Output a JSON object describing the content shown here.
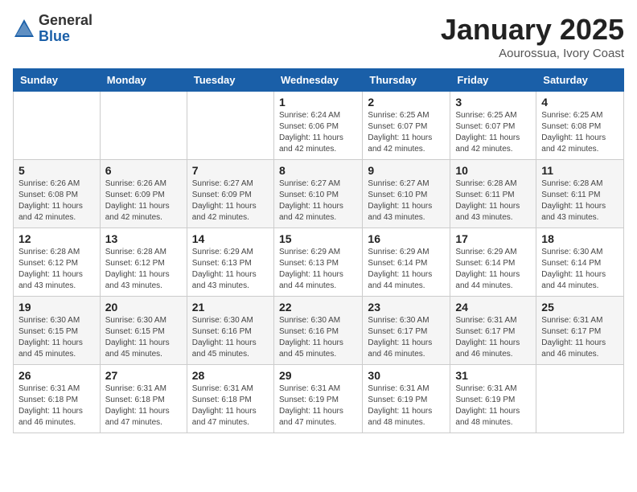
{
  "header": {
    "logo_general": "General",
    "logo_blue": "Blue",
    "title": "January 2025",
    "location": "Aourossua, Ivory Coast"
  },
  "weekdays": [
    "Sunday",
    "Monday",
    "Tuesday",
    "Wednesday",
    "Thursday",
    "Friday",
    "Saturday"
  ],
  "weeks": [
    [
      {
        "day": "",
        "sunrise": "",
        "sunset": "",
        "daylight": ""
      },
      {
        "day": "",
        "sunrise": "",
        "sunset": "",
        "daylight": ""
      },
      {
        "day": "",
        "sunrise": "",
        "sunset": "",
        "daylight": ""
      },
      {
        "day": "1",
        "sunrise": "Sunrise: 6:24 AM",
        "sunset": "Sunset: 6:06 PM",
        "daylight": "Daylight: 11 hours and 42 minutes."
      },
      {
        "day": "2",
        "sunrise": "Sunrise: 6:25 AM",
        "sunset": "Sunset: 6:07 PM",
        "daylight": "Daylight: 11 hours and 42 minutes."
      },
      {
        "day": "3",
        "sunrise": "Sunrise: 6:25 AM",
        "sunset": "Sunset: 6:07 PM",
        "daylight": "Daylight: 11 hours and 42 minutes."
      },
      {
        "day": "4",
        "sunrise": "Sunrise: 6:25 AM",
        "sunset": "Sunset: 6:08 PM",
        "daylight": "Daylight: 11 hours and 42 minutes."
      }
    ],
    [
      {
        "day": "5",
        "sunrise": "Sunrise: 6:26 AM",
        "sunset": "Sunset: 6:08 PM",
        "daylight": "Daylight: 11 hours and 42 minutes."
      },
      {
        "day": "6",
        "sunrise": "Sunrise: 6:26 AM",
        "sunset": "Sunset: 6:09 PM",
        "daylight": "Daylight: 11 hours and 42 minutes."
      },
      {
        "day": "7",
        "sunrise": "Sunrise: 6:27 AM",
        "sunset": "Sunset: 6:09 PM",
        "daylight": "Daylight: 11 hours and 42 minutes."
      },
      {
        "day": "8",
        "sunrise": "Sunrise: 6:27 AM",
        "sunset": "Sunset: 6:10 PM",
        "daylight": "Daylight: 11 hours and 42 minutes."
      },
      {
        "day": "9",
        "sunrise": "Sunrise: 6:27 AM",
        "sunset": "Sunset: 6:10 PM",
        "daylight": "Daylight: 11 hours and 43 minutes."
      },
      {
        "day": "10",
        "sunrise": "Sunrise: 6:28 AM",
        "sunset": "Sunset: 6:11 PM",
        "daylight": "Daylight: 11 hours and 43 minutes."
      },
      {
        "day": "11",
        "sunrise": "Sunrise: 6:28 AM",
        "sunset": "Sunset: 6:11 PM",
        "daylight": "Daylight: 11 hours and 43 minutes."
      }
    ],
    [
      {
        "day": "12",
        "sunrise": "Sunrise: 6:28 AM",
        "sunset": "Sunset: 6:12 PM",
        "daylight": "Daylight: 11 hours and 43 minutes."
      },
      {
        "day": "13",
        "sunrise": "Sunrise: 6:28 AM",
        "sunset": "Sunset: 6:12 PM",
        "daylight": "Daylight: 11 hours and 43 minutes."
      },
      {
        "day": "14",
        "sunrise": "Sunrise: 6:29 AM",
        "sunset": "Sunset: 6:13 PM",
        "daylight": "Daylight: 11 hours and 43 minutes."
      },
      {
        "day": "15",
        "sunrise": "Sunrise: 6:29 AM",
        "sunset": "Sunset: 6:13 PM",
        "daylight": "Daylight: 11 hours and 44 minutes."
      },
      {
        "day": "16",
        "sunrise": "Sunrise: 6:29 AM",
        "sunset": "Sunset: 6:14 PM",
        "daylight": "Daylight: 11 hours and 44 minutes."
      },
      {
        "day": "17",
        "sunrise": "Sunrise: 6:29 AM",
        "sunset": "Sunset: 6:14 PM",
        "daylight": "Daylight: 11 hours and 44 minutes."
      },
      {
        "day": "18",
        "sunrise": "Sunrise: 6:30 AM",
        "sunset": "Sunset: 6:14 PM",
        "daylight": "Daylight: 11 hours and 44 minutes."
      }
    ],
    [
      {
        "day": "19",
        "sunrise": "Sunrise: 6:30 AM",
        "sunset": "Sunset: 6:15 PM",
        "daylight": "Daylight: 11 hours and 45 minutes."
      },
      {
        "day": "20",
        "sunrise": "Sunrise: 6:30 AM",
        "sunset": "Sunset: 6:15 PM",
        "daylight": "Daylight: 11 hours and 45 minutes."
      },
      {
        "day": "21",
        "sunrise": "Sunrise: 6:30 AM",
        "sunset": "Sunset: 6:16 PM",
        "daylight": "Daylight: 11 hours and 45 minutes."
      },
      {
        "day": "22",
        "sunrise": "Sunrise: 6:30 AM",
        "sunset": "Sunset: 6:16 PM",
        "daylight": "Daylight: 11 hours and 45 minutes."
      },
      {
        "day": "23",
        "sunrise": "Sunrise: 6:30 AM",
        "sunset": "Sunset: 6:17 PM",
        "daylight": "Daylight: 11 hours and 46 minutes."
      },
      {
        "day": "24",
        "sunrise": "Sunrise: 6:31 AM",
        "sunset": "Sunset: 6:17 PM",
        "daylight": "Daylight: 11 hours and 46 minutes."
      },
      {
        "day": "25",
        "sunrise": "Sunrise: 6:31 AM",
        "sunset": "Sunset: 6:17 PM",
        "daylight": "Daylight: 11 hours and 46 minutes."
      }
    ],
    [
      {
        "day": "26",
        "sunrise": "Sunrise: 6:31 AM",
        "sunset": "Sunset: 6:18 PM",
        "daylight": "Daylight: 11 hours and 46 minutes."
      },
      {
        "day": "27",
        "sunrise": "Sunrise: 6:31 AM",
        "sunset": "Sunset: 6:18 PM",
        "daylight": "Daylight: 11 hours and 47 minutes."
      },
      {
        "day": "28",
        "sunrise": "Sunrise: 6:31 AM",
        "sunset": "Sunset: 6:18 PM",
        "daylight": "Daylight: 11 hours and 47 minutes."
      },
      {
        "day": "29",
        "sunrise": "Sunrise: 6:31 AM",
        "sunset": "Sunset: 6:19 PM",
        "daylight": "Daylight: 11 hours and 47 minutes."
      },
      {
        "day": "30",
        "sunrise": "Sunrise: 6:31 AM",
        "sunset": "Sunset: 6:19 PM",
        "daylight": "Daylight: 11 hours and 48 minutes."
      },
      {
        "day": "31",
        "sunrise": "Sunrise: 6:31 AM",
        "sunset": "Sunset: 6:19 PM",
        "daylight": "Daylight: 11 hours and 48 minutes."
      },
      {
        "day": "",
        "sunrise": "",
        "sunset": "",
        "daylight": ""
      }
    ]
  ]
}
